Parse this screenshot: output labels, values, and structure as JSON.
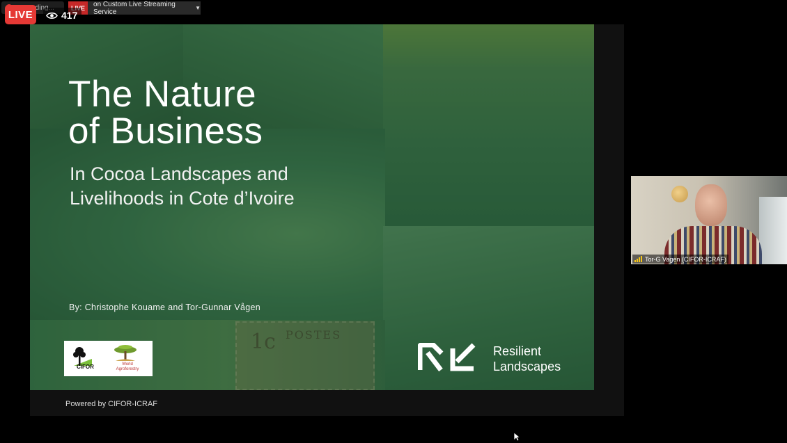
{
  "topbar": {
    "recording_label": "Recording...",
    "stream_live_label": "LIVE",
    "stream_service_label": "on Custom Live Streaming Service",
    "caret_icon": "caret-down"
  },
  "live_badge": {
    "label": "LIVE",
    "color": "#e53935"
  },
  "viewers": {
    "icon": "eye-icon",
    "count": "417"
  },
  "slide": {
    "title_line1": "The Nature",
    "title_line2": "of Business",
    "subtitle_line1": "In Cocoa Landscapes and",
    "subtitle_line2": "Livelihoods in Cote d’Ivoire",
    "byline": "By: Christophe Kouame and Tor-Gunnar Vågen",
    "stamp_text": "POSTES",
    "stamp_number": "1c",
    "logo_cifor": "CIFOR",
    "logo_wa_line1": "World",
    "logo_wa_line2": "Agroforestry",
    "brand_line1": "Resilient",
    "brand_line2": "Landscapes",
    "overlay_color": "#2f5b3b"
  },
  "footer": {
    "powered_by": "Powered by CIFOR-ICRAF"
  },
  "participant": {
    "name": "Tor-G Vagen (CIFOR-ICRAF)",
    "signal_icon": "signal-bars-icon"
  }
}
